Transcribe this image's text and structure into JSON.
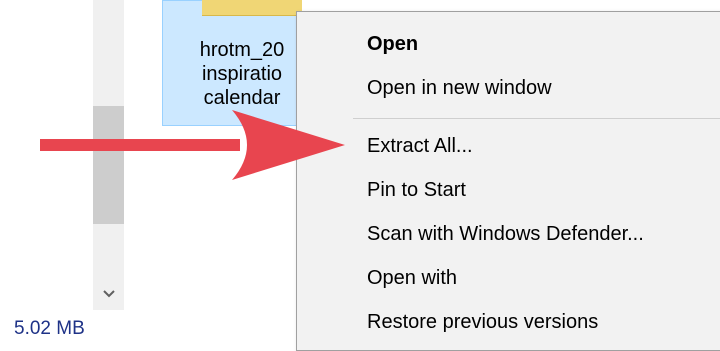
{
  "explorer": {
    "file_label": "hrotm_20\ninspiratio\ncalendar",
    "status_size": "5.02 MB",
    "scroll_down_icon": "chevron-down-icon"
  },
  "context_menu": {
    "items": [
      {
        "label": "Open",
        "bold": true
      },
      {
        "label": "Open in new window"
      },
      {
        "label": "Extract All..."
      },
      {
        "label": "Pin to Start"
      },
      {
        "label": "Scan with Windows Defender..."
      },
      {
        "label": "Open with"
      },
      {
        "label": "Restore previous versions"
      }
    ]
  },
  "annotation": {
    "arrow_color": "#e8454f",
    "icon": "arrow-right-icon"
  },
  "colors": {
    "selection_fill": "#cce8ff",
    "selection_border": "#99d1ff",
    "menu_bg": "#f2f2f2",
    "status_text": "#1e3287"
  }
}
